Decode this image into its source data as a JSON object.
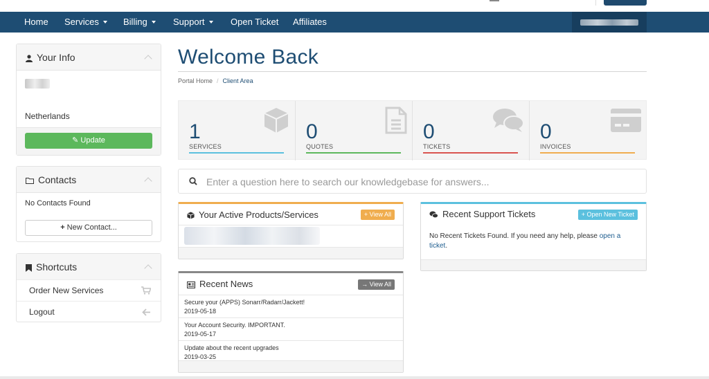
{
  "navbar": {
    "items": [
      {
        "label": "Home",
        "dropdown": false
      },
      {
        "label": "Services",
        "dropdown": true
      },
      {
        "label": "Billing",
        "dropdown": true
      },
      {
        "label": "Support",
        "dropdown": true
      },
      {
        "label": "Open Ticket",
        "dropdown": false
      },
      {
        "label": "Affiliates",
        "dropdown": false
      }
    ]
  },
  "sidebar": {
    "your_info": {
      "title": "Your Info",
      "country": "Netherlands",
      "update_label": "Update"
    },
    "contacts": {
      "title": "Contacts",
      "empty_text": "No Contacts Found",
      "new_contact_label": "New Contact..."
    },
    "shortcuts": {
      "title": "Shortcuts",
      "items": [
        {
          "label": "Order New Services",
          "icon": "cart-icon"
        },
        {
          "label": "Logout",
          "icon": "arrow-left-icon"
        }
      ]
    }
  },
  "main": {
    "title": "Welcome Back",
    "breadcrumb": [
      "Portal Home",
      "Client Area"
    ],
    "stats": [
      {
        "value": "1",
        "label": "SERVICES",
        "color": "#5bc0de",
        "icon": "cube-icon"
      },
      {
        "value": "0",
        "label": "QUOTES",
        "color": "#5cb85c",
        "icon": "document-icon"
      },
      {
        "value": "0",
        "label": "TICKETS",
        "color": "#d9534f",
        "icon": "chat-bubbles-icon"
      },
      {
        "value": "0",
        "label": "INVOICES",
        "color": "#f0ad4e",
        "icon": "credit-card-icon"
      }
    ],
    "kb_search": {
      "placeholder": "Enter a question here to search our knowledgebase for answers..."
    },
    "products_card": {
      "title": "Your Active Products/Services",
      "view_all_label": "View All",
      "accent": "#f0ad4e"
    },
    "news_card": {
      "title": "Recent News",
      "view_all_label": "View All",
      "accent": "#888888",
      "items": [
        {
          "title": "Secure your (APPS) Sonarr/Radarr/Jackett!",
          "date": "2019-05-18"
        },
        {
          "title": "Your Account Security. IMPORTANT.",
          "date": "2019-05-17"
        },
        {
          "title": "Update about the recent upgrades",
          "date": "2019-03-25"
        }
      ]
    },
    "tickets_card": {
      "title": "Recent Support Tickets",
      "open_new_label": "Open New Ticket",
      "accent": "#5bc0de",
      "empty_text": "No Recent Tickets Found. If you need any help, please",
      "link_text": "open a ticket",
      "trailing": "."
    }
  }
}
